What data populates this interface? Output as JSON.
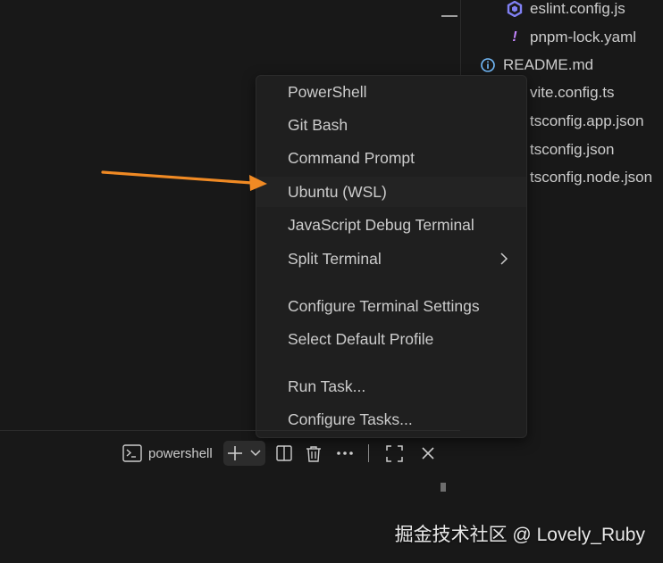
{
  "explorer": {
    "files": [
      {
        "name": "eslint.config.js",
        "icon": "eslint-icon",
        "color": "#8080f2"
      },
      {
        "name": "pnpm-lock.yaml",
        "icon": "exclamation-icon",
        "color": "#c586ff"
      },
      {
        "name": "README.md",
        "icon": "info-icon",
        "color": "#75beff"
      },
      {
        "name": "vite.config.ts",
        "icon": "",
        "color": ""
      },
      {
        "name": "tsconfig.app.json",
        "icon": "",
        "color": ""
      },
      {
        "name": "tsconfig.json",
        "icon": "",
        "color": ""
      },
      {
        "name": "tsconfig.node.json",
        "icon": "",
        "color": ""
      }
    ]
  },
  "menu": {
    "items": [
      {
        "label": "PowerShell"
      },
      {
        "label": "Git Bash"
      },
      {
        "label": "Command Prompt"
      },
      {
        "label": "Ubuntu (WSL)"
      },
      {
        "label": "JavaScript Debug Terminal"
      },
      {
        "label": "Split Terminal"
      },
      {
        "label": "Configure Terminal Settings"
      },
      {
        "label": "Select Default Profile"
      },
      {
        "label": "Run Task..."
      },
      {
        "label": "Configure Tasks..."
      }
    ],
    "hovered_item": "Ubuntu (WSL)"
  },
  "terminal": {
    "label": "powershell",
    "icons": [
      "terminal-icon",
      "add-icon",
      "chevron-down-icon",
      "split-icon",
      "trash-icon",
      "more-icon",
      "maximize-icon",
      "close-icon"
    ]
  },
  "watermark": "掘金技术社区 @ Lovely_Ruby",
  "colors": {
    "background": "#181818",
    "menu_bg": "#1f1f1f",
    "text": "#cccccc",
    "annotation_arrow": "#f08a24"
  }
}
